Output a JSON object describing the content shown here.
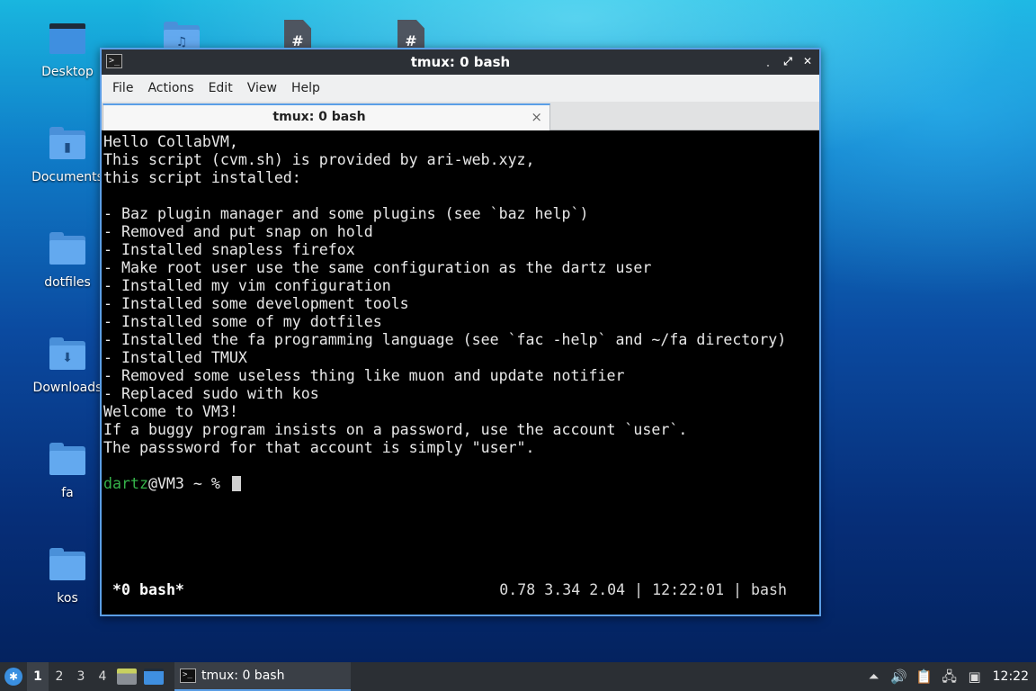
{
  "desktop": {
    "icons": [
      {
        "label": "Desktop",
        "icon": "desktop-monitor-icon"
      },
      {
        "label": "Documents",
        "icon": "documents-folder-icon"
      },
      {
        "label": "dotfiles",
        "icon": "folder-icon"
      },
      {
        "label": "Downloads",
        "icon": "downloads-folder-icon"
      },
      {
        "label": "fa",
        "icon": "folder-icon"
      },
      {
        "label": "kos",
        "icon": "folder-icon"
      }
    ],
    "top_icons": [
      {
        "icon": "music-folder-icon",
        "glyph": "♫"
      },
      {
        "icon": "text-file-icon",
        "glyph": "#"
      },
      {
        "icon": "text-file-icon",
        "glyph": "#"
      }
    ]
  },
  "window": {
    "title": "tmux: 0 bash",
    "buttons": {
      "minimize": "˯",
      "maximize": "⤢",
      "close": "✕"
    },
    "menu": [
      "File",
      "Actions",
      "Edit",
      "View",
      "Help"
    ],
    "tab": {
      "label": "tmux: 0 bash",
      "close": "×"
    }
  },
  "terminal": {
    "lines": [
      "Hello CollabVM,",
      "This script (cvm.sh) is provided by ari-web.xyz,",
      "this script installed:",
      "",
      "- Baz plugin manager and some plugins (see `baz help`)",
      "- Removed and put snap on hold",
      "- Installed snapless firefox",
      "- Make root user use the same configuration as the dartz user",
      "- Installed my vim configuration",
      "- Installed some development tools",
      "- Installed some of my dotfiles",
      "- Installed the fa programming language (see `fac -help` and ~/fa directory)",
      "- Installed TMUX",
      "- Removed some useless thing like muon and update notifier",
      "- Replaced sudo with kos",
      "Welcome to VM3!",
      "If a buggy program insists on a password, use the account `user`.",
      "The passsword for that account is simply \"user\".",
      ""
    ],
    "prompt": {
      "user": "dartz",
      "host_path": "@VM3 ~ % "
    },
    "status_left": "*0 bash*",
    "status_right": "0.78 3.34 2.04 | 12:22:01 | bash"
  },
  "taskbar": {
    "start_icon": "start-menu-icon",
    "workspaces": [
      "1",
      "2",
      "3",
      "4"
    ],
    "active_workspace": "1",
    "task": "tmux: 0 bash",
    "clock": "12:22",
    "accent": "#5a9ee6"
  }
}
